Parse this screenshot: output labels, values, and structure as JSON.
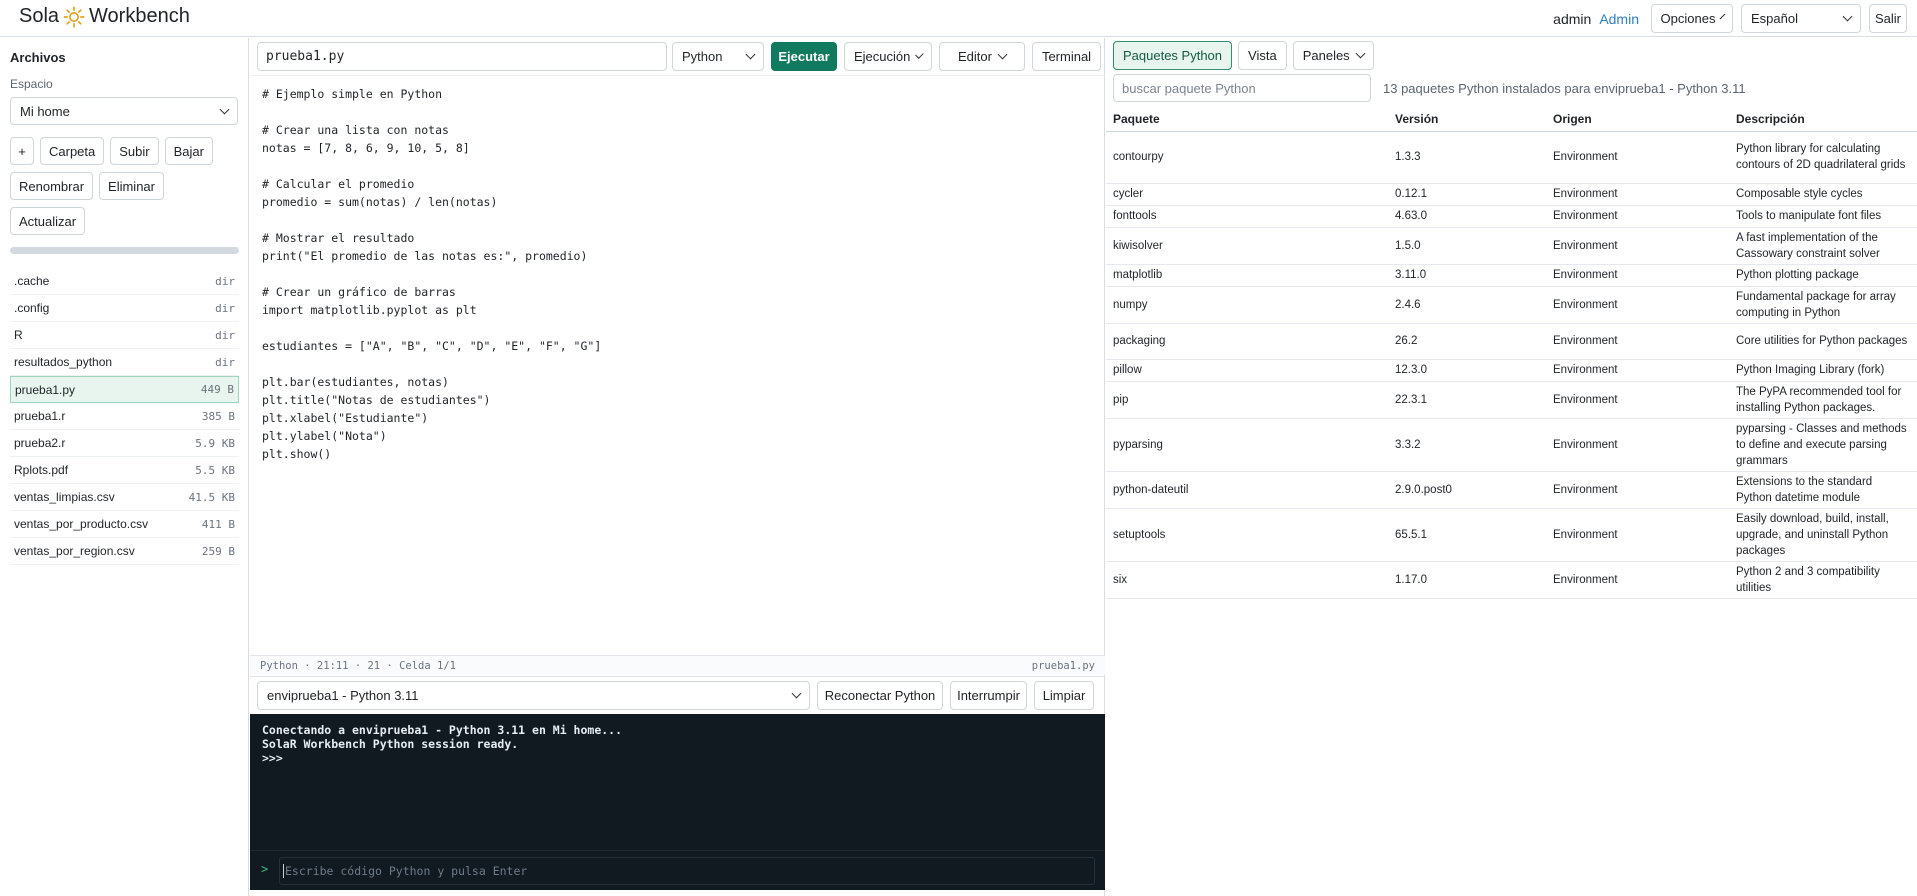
{
  "brand": {
    "left": "Sola",
    "right": "Workbench",
    "accent": "#e0a21a"
  },
  "topbar": {
    "user": "admin",
    "admin_link": "Admin",
    "options_label": "Opciones",
    "language": "Español",
    "logout_label": "Salir"
  },
  "sidebar": {
    "title": "Archivos",
    "space_label": "Espacio",
    "space_value": "Mi home",
    "buttons": {
      "new": "+",
      "folder": "Carpeta",
      "upload": "Subir",
      "download": "Bajar",
      "rename": "Renombrar",
      "delete": "Eliminar",
      "refresh": "Actualizar"
    },
    "files": [
      {
        "name": ".cache",
        "meta": "dir"
      },
      {
        "name": ".config",
        "meta": "dir"
      },
      {
        "name": "R",
        "meta": "dir"
      },
      {
        "name": "resultados_python",
        "meta": "dir"
      },
      {
        "name": "prueba1.py",
        "meta": "449 B"
      },
      {
        "name": "prueba1.r",
        "meta": "385 B"
      },
      {
        "name": "prueba2.r",
        "meta": "5.9 KB"
      },
      {
        "name": "Rplots.pdf",
        "meta": "5.5 KB"
      },
      {
        "name": "ventas_limpias.csv",
        "meta": "41.5 KB"
      },
      {
        "name": "ventas_por_producto.csv",
        "meta": "411 B"
      },
      {
        "name": "ventas_por_region.csv",
        "meta": "259 B"
      }
    ],
    "active_file_index": 4
  },
  "editor": {
    "filename": "prueba1.py",
    "language": "Python",
    "run_label": "Ejecutar",
    "execution_label": "Ejecución",
    "editor_label": "Editor",
    "terminal_label": "Terminal",
    "code_lines": [
      "# Ejemplo simple en Python",
      "",
      "# Crear una lista con notas",
      "notas = [7, 8, 6, 9, 10, 5, 8]",
      "",
      "# Calcular el promedio",
      "promedio = sum(notas) / len(notas)",
      "",
      "# Mostrar el resultado",
      "print(\"El promedio de las notas es:\", promedio)",
      "",
      "# Crear un gráfico de barras",
      "import matplotlib.pyplot as plt",
      "",
      "estudiantes = [\"A\", \"B\", \"C\", \"D\", \"E\", \"F\", \"G\"]",
      "",
      "plt.bar(estudiantes, notas)",
      "plt.title(\"Notas de estudiantes\")",
      "plt.xlabel(\"Estudiante\")",
      "plt.ylabel(\"Nota\")",
      "plt.show()"
    ],
    "status_left": "Python · 21:11 · 21 · Celda 1/1",
    "status_right": "prueba1.py"
  },
  "console": {
    "environment": "enviprueba1 - Python 3.11",
    "reconnect_label": "Reconectar Python",
    "interrupt_label": "Interrumpir",
    "clear_label": "Limpiar",
    "output_lines": [
      "Conectando a enviprueba1 - Python 3.11 en Mi home...",
      "SolaR Workbench Python session ready.",
      ">>>"
    ],
    "prompt": ">",
    "input_placeholder": "Escribe código Python y pulsa Enter"
  },
  "packages": {
    "tabs": [
      "Paquetes Python",
      "Vista",
      "Paneles"
    ],
    "search_placeholder": "buscar paquete Python",
    "count_text": "13 paquetes Python instalados para enviprueba1 - Python 3.11",
    "columns": [
      "Paquete",
      "Versión",
      "Origen",
      "Descripción"
    ],
    "rows": [
      {
        "name": "contourpy",
        "version": "1.3.3",
        "origin": "Environment",
        "description": "Python library for calculating contours of 2D quadrilateral grids"
      },
      {
        "name": "cycler",
        "version": "0.12.1",
        "origin": "Environment",
        "description": "Composable style cycles"
      },
      {
        "name": "fonttools",
        "version": "4.63.0",
        "origin": "Environment",
        "description": "Tools to manipulate font files"
      },
      {
        "name": "kiwisolver",
        "version": "1.5.0",
        "origin": "Environment",
        "description": "A fast implementation of the Cassowary constraint solver"
      },
      {
        "name": "matplotlib",
        "version": "3.11.0",
        "origin": "Environment",
        "description": "Python plotting package"
      },
      {
        "name": "numpy",
        "version": "2.4.6",
        "origin": "Environment",
        "description": "Fundamental package for array computing in Python"
      },
      {
        "name": "packaging",
        "version": "26.2",
        "origin": "Environment",
        "description": "Core utilities for Python packages"
      },
      {
        "name": "pillow",
        "version": "12.3.0",
        "origin": "Environment",
        "description": "Python Imaging Library (fork)"
      },
      {
        "name": "pip",
        "version": "22.3.1",
        "origin": "Environment",
        "description": "The PyPA recommended tool for installing Python packages."
      },
      {
        "name": "pyparsing",
        "version": "3.3.2",
        "origin": "Environment",
        "description": "pyparsing - Classes and methods to define and execute parsing grammars"
      },
      {
        "name": "python-dateutil",
        "version": "2.9.0.post0",
        "origin": "Environment",
        "description": "Extensions to the standard Python datetime module"
      },
      {
        "name": "setuptools",
        "version": "65.5.1",
        "origin": "Environment",
        "description": "Easily download, build, install, upgrade, and uninstall Python packages"
      },
      {
        "name": "six",
        "version": "1.17.0",
        "origin": "Environment",
        "description": "Python 2 and 3 compatibility utilities"
      }
    ]
  }
}
